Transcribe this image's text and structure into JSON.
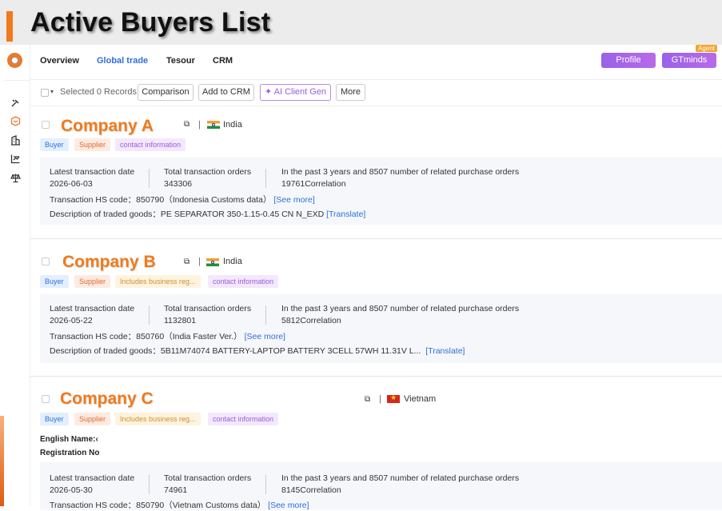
{
  "page": {
    "title": "Active Buyers List"
  },
  "nav": {
    "tabs": [
      "Overview",
      "Global trade",
      "Tesour",
      "CRM"
    ],
    "active_tab": "Global trade",
    "profile_label": "Profile",
    "gtminds_label": "GTminds",
    "agent_tag": "Agent"
  },
  "toolbar": {
    "selected_text": "Selected 0 Records",
    "comparison": "Comparison",
    "add_crm": "Add to CRM",
    "ai_client_gen": "AI Client Gen",
    "more": "More"
  },
  "labels": {
    "latest_date": "Latest transaction date",
    "total_orders": "Total transaction orders",
    "past_years": "In the past 3 years and 8507 number of related purchase orders",
    "hs_code": "Transaction HS code：",
    "description": "Description of traded goods：",
    "see_more": "[See more]",
    "translate": "[Translate]",
    "english_name": "English Name:‹",
    "registration_no": "Registration No"
  },
  "companies": [
    {
      "name": "Company A",
      "country": "India",
      "tags": [
        "Buyer",
        "Supplier",
        "contact information"
      ],
      "latest_date": "2026-06-03",
      "total_orders": "343306",
      "correlation": "19761Correlation",
      "hs_code": "850790（Indonesia Customs data）",
      "goods": "PE SEPARATOR 350-1.15-0.45 CN N_EXD"
    },
    {
      "name": "Company B",
      "country": "India",
      "tags": [
        "Buyer",
        "Supplier",
        "Includes business reg...",
        "contact information"
      ],
      "latest_date": "2026-05-22",
      "total_orders": "1132801",
      "correlation": "5812Correlation",
      "hs_code": "850760（India Faster Ver.）",
      "goods": "5B11M74074 BATTERY-LAPTOP BATTERY 3CELL 57WH 11.31V L..."
    },
    {
      "name": "Company C",
      "country": "Vietnam",
      "tags": [
        "Buyer",
        "Supplier",
        "Includes business reg...",
        "contact information"
      ],
      "latest_date": "2026-05-30",
      "total_orders": "74961",
      "correlation": "8145Correlation",
      "hs_code": "850790（Vietnam Customs data）"
    }
  ],
  "sidebar": {
    "icons": [
      "logo-icon",
      "tools-icon",
      "box-icon",
      "building-icon",
      "chart-icon",
      "scale-icon"
    ]
  },
  "colors": {
    "accent": "#f07a1c",
    "link": "#2f6fde",
    "purple": "#9a5ce0"
  }
}
